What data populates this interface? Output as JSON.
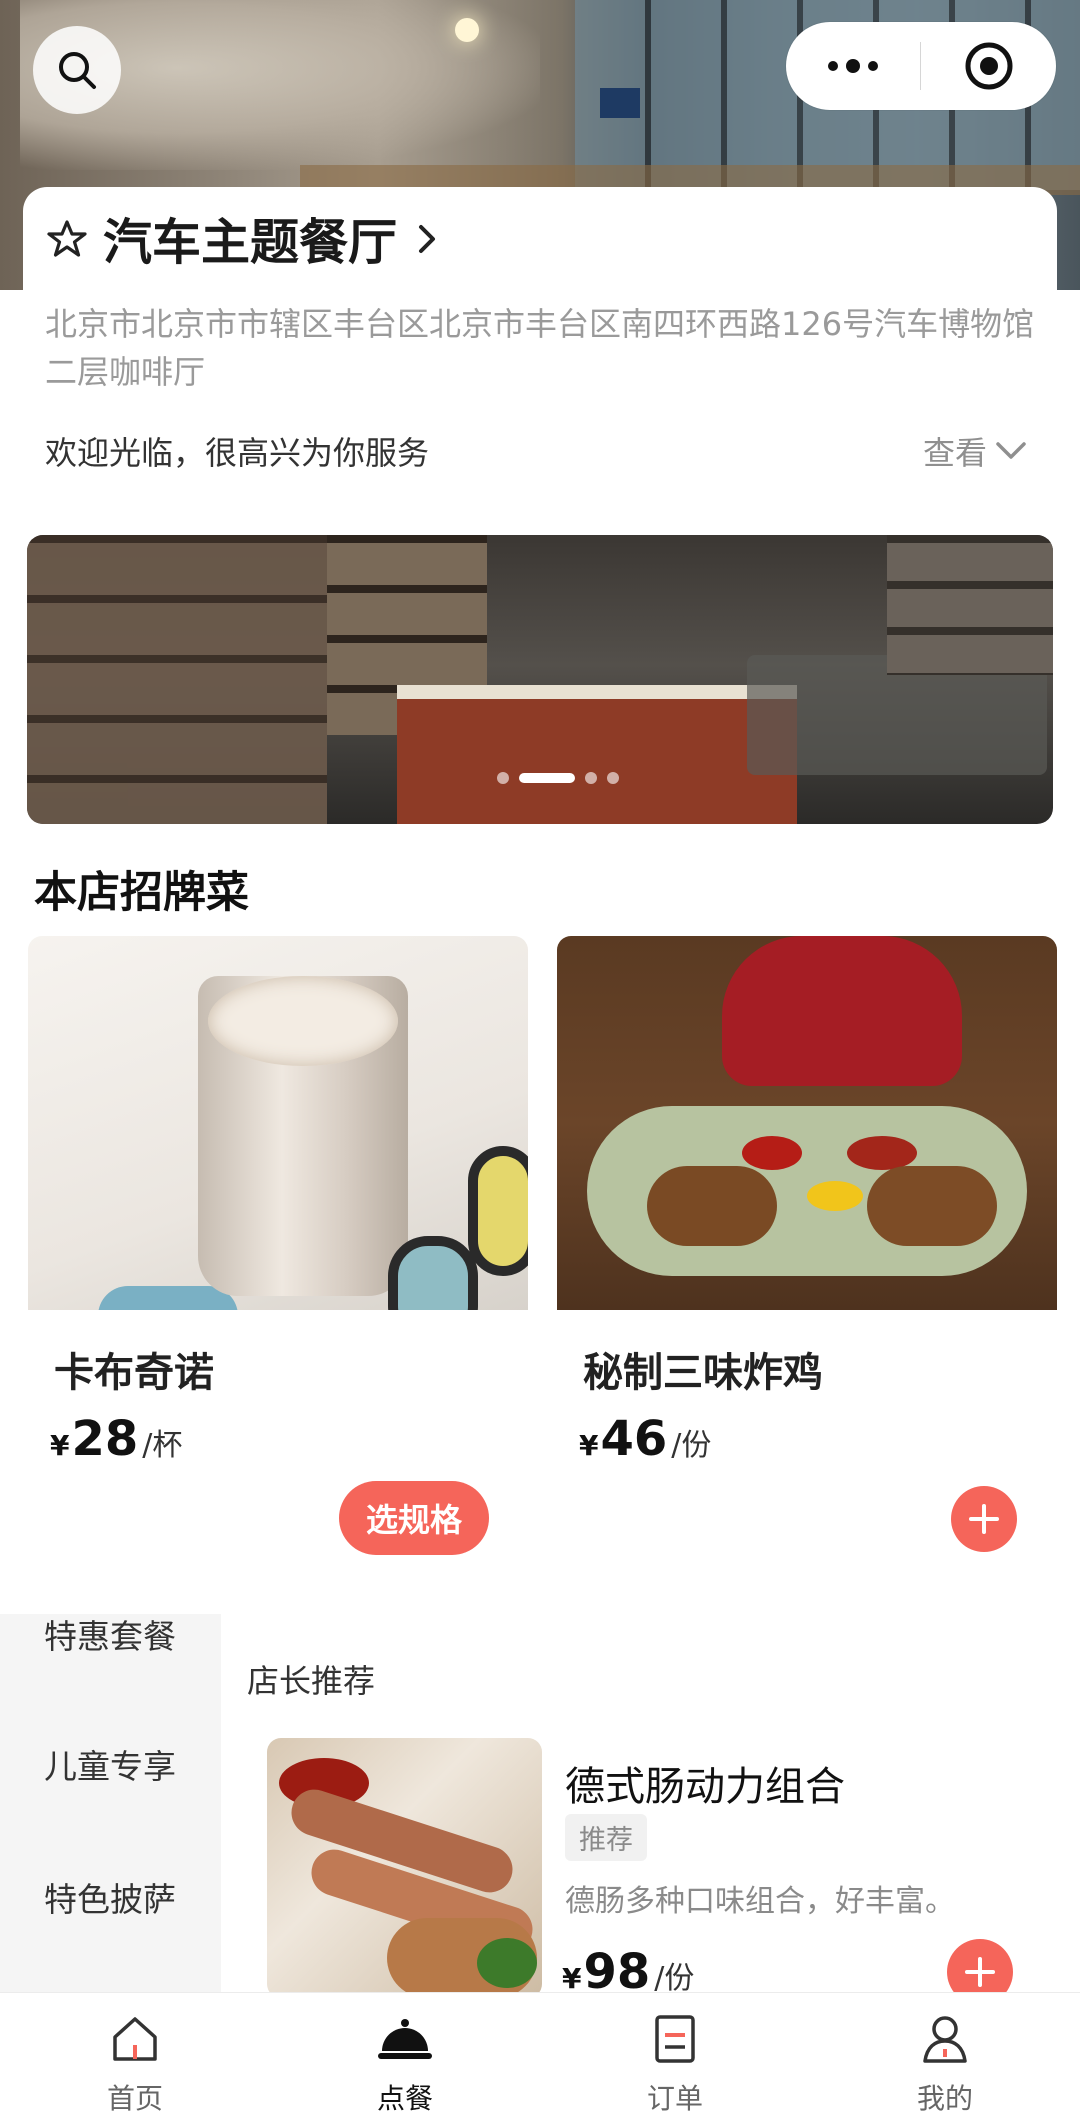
{
  "store": {
    "name": "汽车主题餐厅",
    "address": "北京市北京市市辖区丰台区北京市丰台区南四环西路126号汽车博物馆二层咖啡厅",
    "welcome": "欢迎光临，很高兴为你服务",
    "view_more": "查看"
  },
  "banner": {
    "dot_count": 4,
    "active_index": 1
  },
  "signature": {
    "title": "本店招牌菜",
    "items": [
      {
        "name": "卡布奇诺",
        "currency": "¥",
        "price": "28",
        "unit": "/杯",
        "action": "选规格"
      },
      {
        "name": "秘制三味炸鸡",
        "currency": "¥",
        "price": "46",
        "unit": "/份"
      }
    ]
  },
  "menu": {
    "categories": [
      "特惠套餐",
      "儿童专享",
      "特色披萨"
    ],
    "section_title": "店长推荐",
    "items": [
      {
        "name": "德式肠动力组合",
        "tag": "推荐",
        "desc": "德肠多种口味组合，好丰富。",
        "currency": "¥",
        "price": "98",
        "unit": "/份"
      }
    ]
  },
  "tabbar": {
    "tabs": [
      {
        "label": "首页",
        "icon": "home-icon"
      },
      {
        "label": "点餐",
        "icon": "dining-cloche-icon",
        "active": true
      },
      {
        "label": "订单",
        "icon": "order-list-icon"
      },
      {
        "label": "我的",
        "icon": "user-icon"
      }
    ]
  },
  "colors": {
    "accent": "#f5655a",
    "muted": "#9a9a9a",
    "sidebar_bg": "#f5f5f5"
  }
}
